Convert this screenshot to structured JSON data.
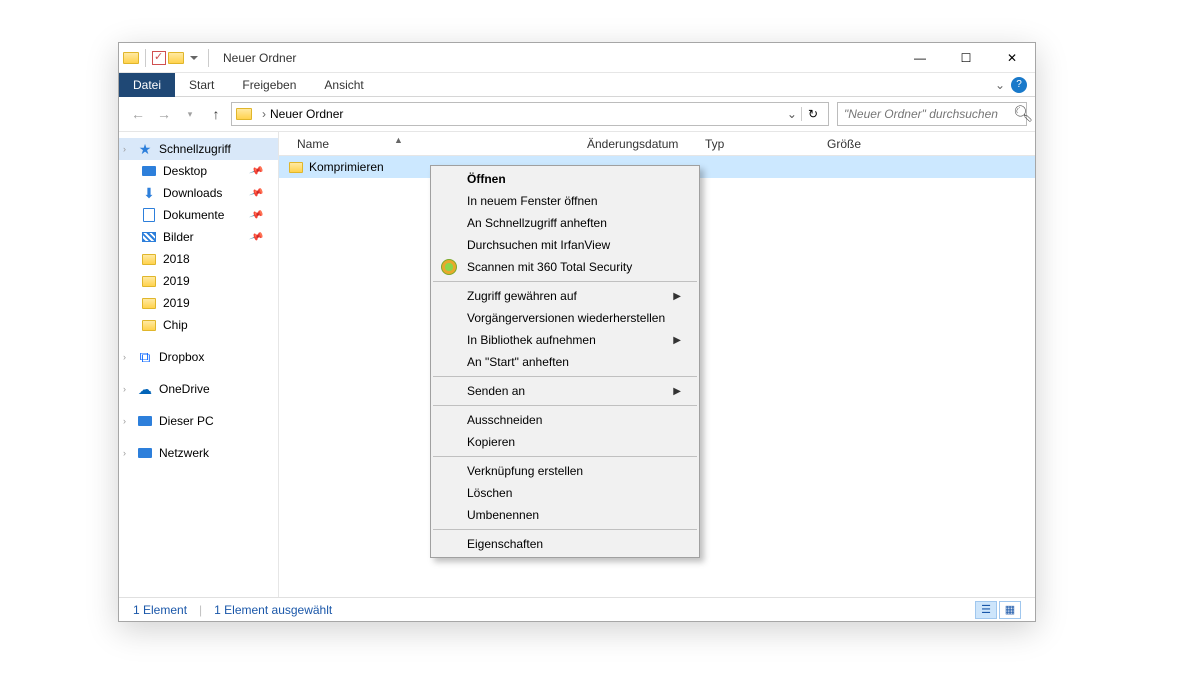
{
  "titlebar": {
    "title": "Neuer Ordner"
  },
  "ribbon": {
    "file": "Datei",
    "tabs": [
      "Start",
      "Freigeben",
      "Ansicht"
    ]
  },
  "breadcrumb": {
    "current": "Neuer Ordner"
  },
  "search": {
    "placeholder": "\"Neuer Ordner\" durchsuchen"
  },
  "columns": {
    "name": "Name",
    "date": "Änderungsdatum",
    "type": "Typ",
    "size": "Größe"
  },
  "files": {
    "rows": [
      {
        "name": "Komprimieren"
      }
    ]
  },
  "sidebar": {
    "quick": "Schnellzugriff",
    "pinned": [
      {
        "label": "Desktop"
      },
      {
        "label": "Downloads"
      },
      {
        "label": "Dokumente"
      },
      {
        "label": "Bilder"
      }
    ],
    "recent": [
      {
        "label": "2018"
      },
      {
        "label": "2019"
      },
      {
        "label": "2019"
      },
      {
        "label": "Chip"
      }
    ],
    "dropbox": "Dropbox",
    "onedrive": "OneDrive",
    "thispc": "Dieser PC",
    "network": "Netzwerk"
  },
  "context": {
    "open": "Öffnen",
    "newwin": "In neuem Fenster öffnen",
    "pin": "An Schnellzugriff anheften",
    "irfan": "Durchsuchen mit IrfanView",
    "scan": "Scannen mit 360 Total Security",
    "access": "Zugriff gewähren auf",
    "prev": "Vorgängerversionen wiederherstellen",
    "lib": "In Bibliothek aufnehmen",
    "start": "An \"Start\" anheften",
    "send": "Senden an",
    "cut": "Ausschneiden",
    "copy": "Kopieren",
    "link": "Verknüpfung erstellen",
    "delete": "Löschen",
    "rename": "Umbenennen",
    "props": "Eigenschaften"
  },
  "status": {
    "count": "1 Element",
    "selected": "1 Element ausgewählt"
  }
}
